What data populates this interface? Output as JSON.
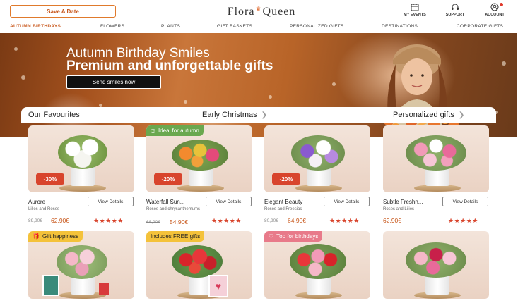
{
  "header": {
    "save_date_label": "Save A Date",
    "logo_text_left": "Flora",
    "logo_text_right": "Queen",
    "tools": [
      {
        "label": "MY EVENTS",
        "icon": "calendar-icon"
      },
      {
        "label": "SUPPORT",
        "icon": "headset-icon"
      },
      {
        "label": "ACCOUNT",
        "icon": "user-icon"
      }
    ]
  },
  "nav": [
    "AUTUMN BIRTHDAYS",
    "FLOWERS",
    "PLANTS",
    "GIFT BASKETS",
    "PERSONALIZED GIFTS",
    "DESTINATIONS",
    "CORPORATE GIFTS"
  ],
  "hero": {
    "title": "Autumn Birthday Smiles",
    "subtitle": "Premium and unforgettable gifts",
    "cta": "Send smiles now"
  },
  "tabs": [
    "Our Favourites",
    "Early Christmas",
    "Personalized gifts"
  ],
  "products": [
    {
      "name": "Aurore",
      "desc": "Lilies and Roses",
      "old_price": "89,90€",
      "price": "62,90€",
      "discount": "-30%",
      "tag": "",
      "rating": 5,
      "button": "View Details"
    },
    {
      "name": "Waterfall Sun...",
      "desc": "Roses and chrysanthemums",
      "old_price": "68,90€",
      "price": "54,90€",
      "discount": "-20%",
      "tag": "Ideal for autumn",
      "rating": 5,
      "button": "View Details"
    },
    {
      "name": "Elegant Beauty",
      "desc": "Roses and Freesias",
      "old_price": "80,90€",
      "price": "64,90€",
      "discount": "-20%",
      "tag": "",
      "rating": 5,
      "button": "View Details"
    },
    {
      "name": "Subtle Freshn...",
      "desc": "Roses and Lilies",
      "old_price": "",
      "price": "62,90€",
      "discount": "",
      "tag": "",
      "rating": 5,
      "button": "View Details"
    }
  ],
  "products_row2_tags": [
    "Gift happiness",
    "Includes FREE gifts",
    "Top for birthdays",
    ""
  ],
  "stars_glyph": "★★★★★",
  "colors": {
    "accent": "#c8571b",
    "discount": "#d8442c",
    "tag_green": "#6aa84f",
    "tag_yellow": "#f4c23a",
    "tag_pink": "#e87a8a"
  }
}
